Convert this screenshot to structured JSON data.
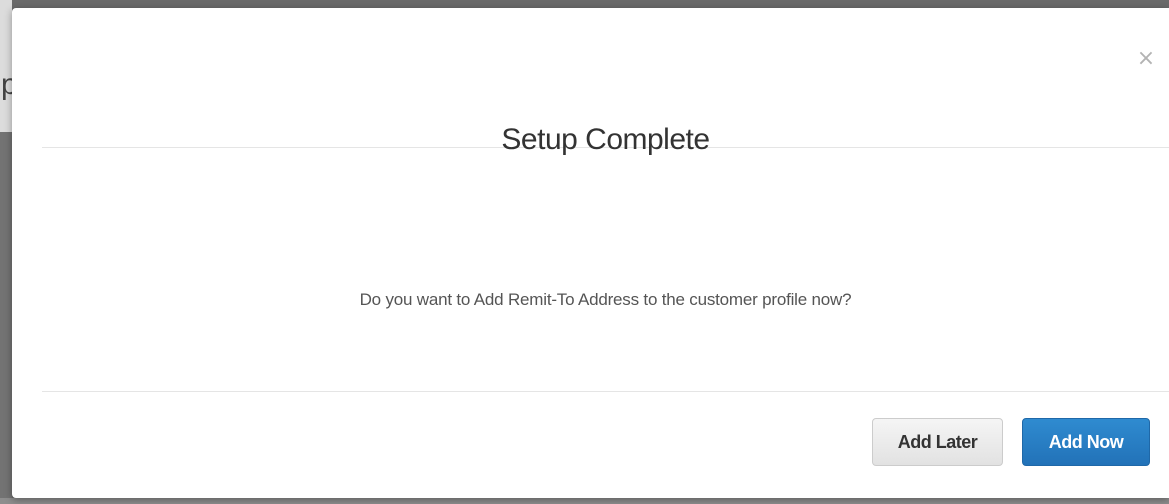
{
  "backdrop": {
    "fragment_text": "p"
  },
  "dialog": {
    "title": "Setup Complete",
    "close_symbol": "×",
    "close_icon": "close-icon",
    "message": "Do you want to Add Remit-To Address to the customer profile now?",
    "buttons": {
      "add_later_label": "Add Later",
      "add_now_label": "Add Now"
    }
  },
  "colors": {
    "primary_button": "#2a7fc4",
    "secondary_button": "#e8e8e8",
    "overlay": "#6a6a6a"
  }
}
